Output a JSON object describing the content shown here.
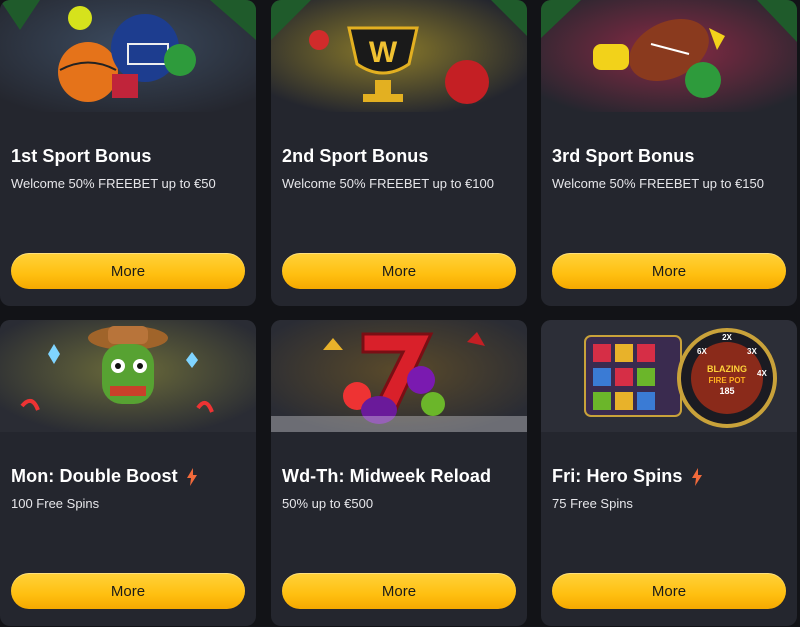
{
  "accent": "#ffc21a",
  "card_bg": "#24262e",
  "cards": [
    {
      "title": "1st Sport Bonus",
      "description": "Welcome 50% FREEBET up to €50",
      "button": "More",
      "badge_icon": ""
    },
    {
      "title": "2nd Sport Bonus",
      "description": "Welcome 50% FREEBET up to €100",
      "button": "More",
      "badge_icon": ""
    },
    {
      "title": "3rd Sport Bonus",
      "description": "Welcome 50% FREEBET up to €150",
      "button": "More",
      "badge_icon": ""
    },
    {
      "title": "Mon: Double Boost",
      "description": "100 Free Spins",
      "button": "More",
      "badge_icon": "lightning-icon"
    },
    {
      "title": "Wd-Th: Midweek Reload",
      "description": "50% up to €500",
      "button": "More",
      "badge_icon": ""
    },
    {
      "title": "Fri: Hero Spins",
      "description": "75 Free Spins",
      "button": "More",
      "badge_icon": "lightning-icon"
    }
  ],
  "art": {
    "trophy_letter": "W",
    "wheel_text": [
      "BLAZING",
      "FIRE POT",
      "185"
    ],
    "wheel_multipliers": [
      "6X",
      "2X",
      "3X",
      "4X"
    ]
  }
}
